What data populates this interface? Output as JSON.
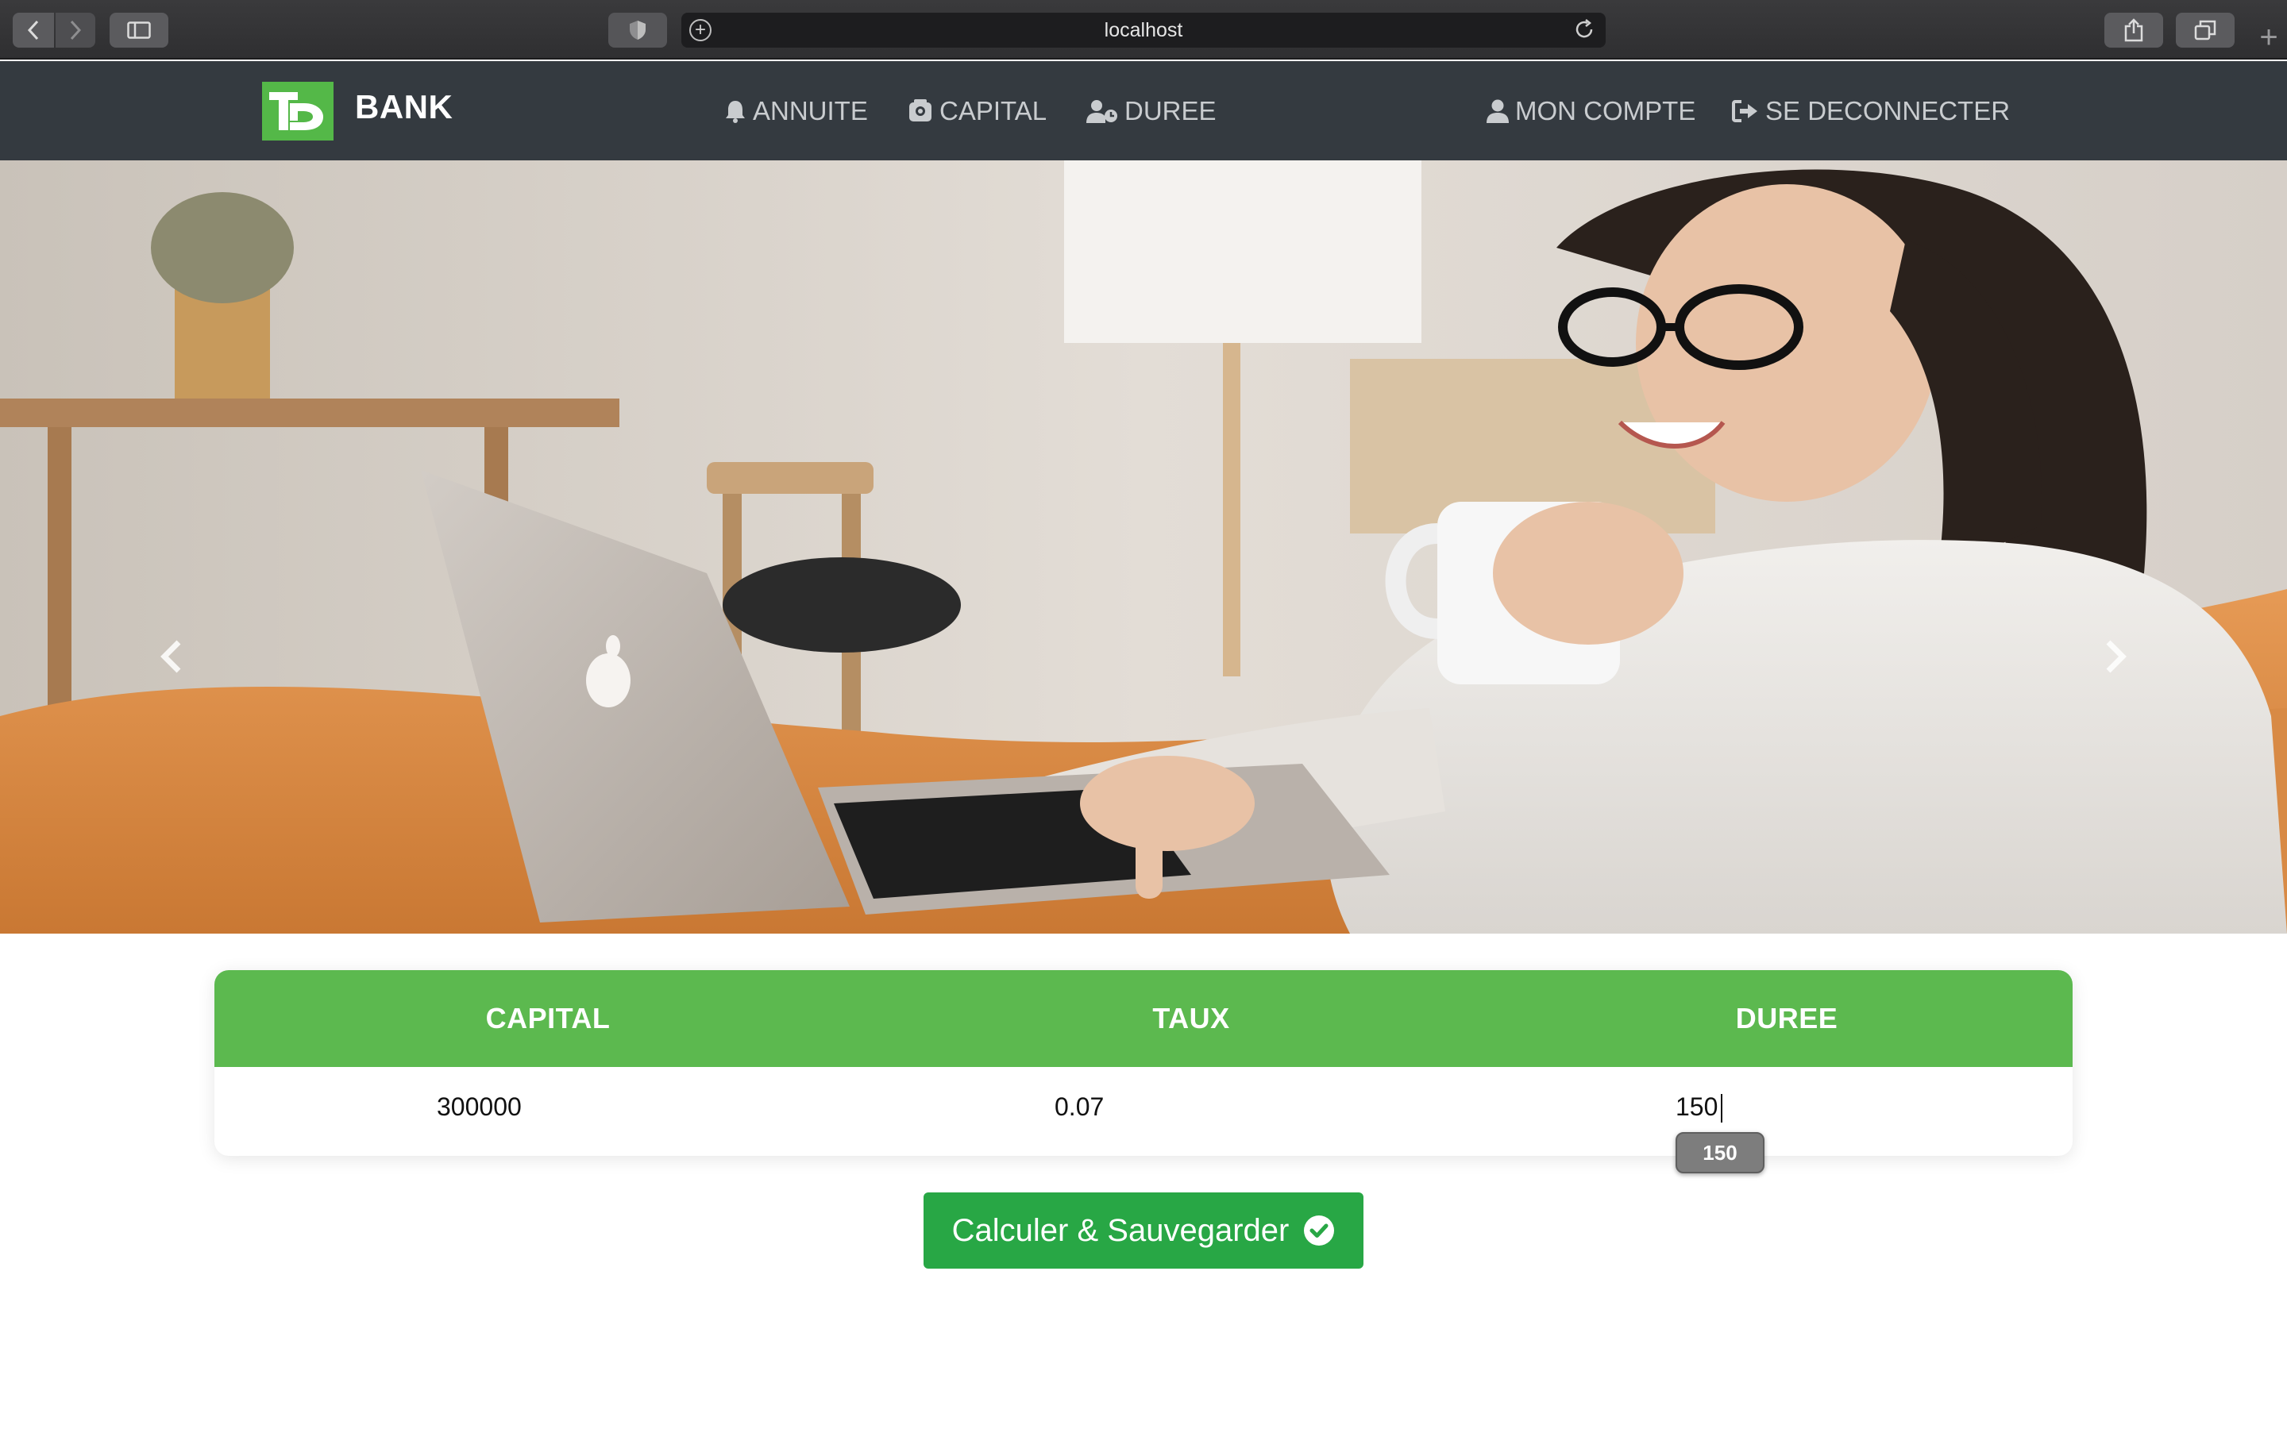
{
  "browser": {
    "url": "localhost"
  },
  "navbar": {
    "brand": {
      "logo_text": "TD",
      "name": "BANK"
    },
    "links": [
      {
        "label": "ANNUITE",
        "icon": "bell-icon"
      },
      {
        "label": "CAPITAL",
        "icon": "piggy-bank-icon"
      },
      {
        "label": "DUREE",
        "icon": "user-clock-icon"
      }
    ],
    "account": {
      "label": "MON COMPTE",
      "icon": "user-icon"
    },
    "logout": {
      "label": "SE DECONNECTER",
      "icon": "sign-out-icon"
    }
  },
  "hero": {
    "image_description": "woman with glasses holding a mug using a laptop",
    "prev_icon": "chevron-left-icon",
    "next_icon": "chevron-right-icon"
  },
  "form": {
    "headers": {
      "capital": "CAPITAL",
      "taux": "TAUX",
      "duree": "DUREE"
    },
    "values": {
      "capital": "300000",
      "taux": "0.07",
      "duree": "150"
    },
    "autocomplete_suggestion": "150"
  },
  "submit": {
    "label": "Calculer & Sauvegarder",
    "icon": "check-circle-icon"
  },
  "colors": {
    "navbar_bg": "#343a40",
    "brand_green": "#54b848",
    "header_green": "#5cb94f",
    "button_green": "#28a745"
  }
}
